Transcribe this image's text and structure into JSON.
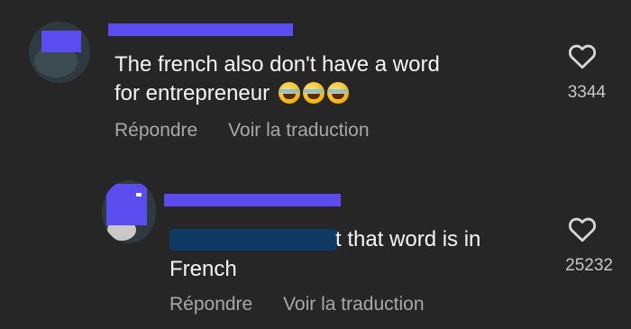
{
  "comments": [
    {
      "body_line1": "The french also don't have a word",
      "body_line2": "for entrepreneur",
      "emojis": [
        "face-with-tears-of-joy-icon",
        "face-with-tears-of-joy-icon",
        "face-with-tears-of-joy-icon"
      ],
      "reply_label": "Répondre",
      "translate_label": "Voir la traduction",
      "likes": "3344"
    },
    {
      "body_line1_visible": "t that word is in",
      "body_line2": "French",
      "reply_label": "Répondre",
      "translate_label": "Voir la traduction",
      "likes": "25232"
    }
  ],
  "colors": {
    "background": "#262626",
    "redaction": "#5b4cf0",
    "redaction_dark": "#0f3a63",
    "muted_text": "#a8a8a8"
  }
}
